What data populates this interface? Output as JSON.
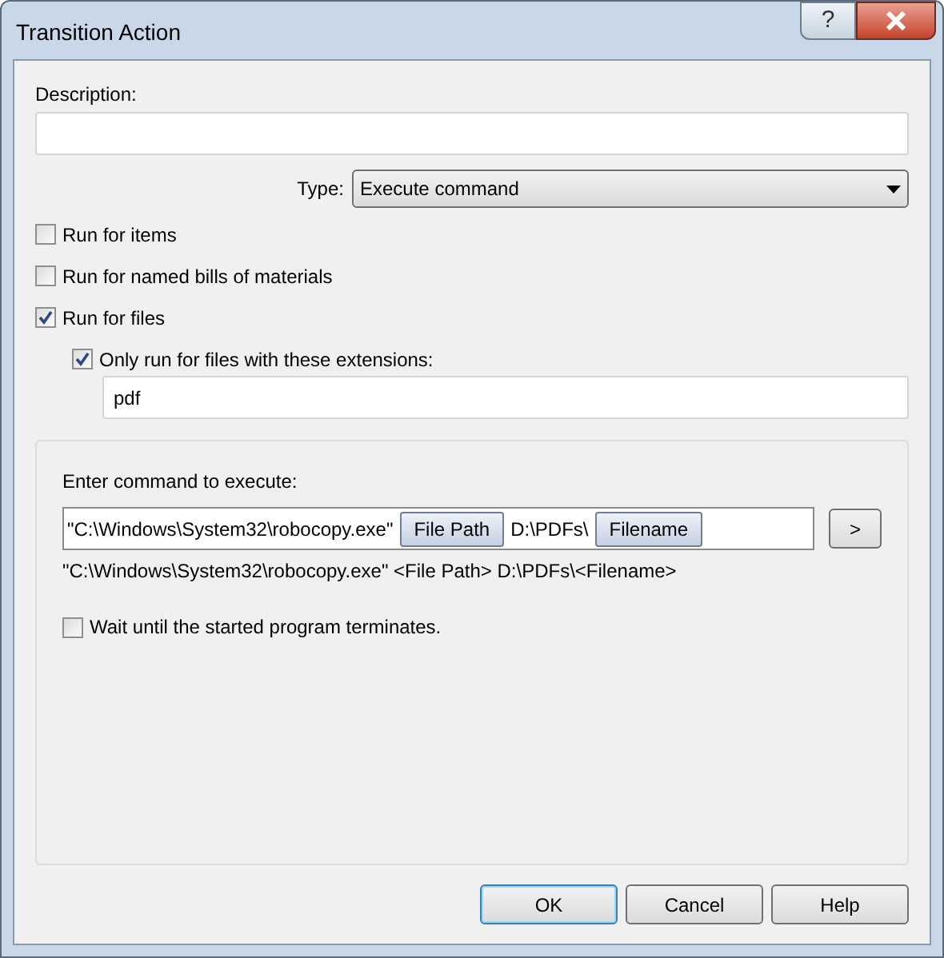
{
  "window": {
    "title": "Transition Action",
    "help_label": "?"
  },
  "description": {
    "label": "Description:"
  },
  "type": {
    "label": "Type:",
    "value": "Execute command"
  },
  "options": [
    {
      "label": "Run for items",
      "checked": false
    },
    {
      "label": "Run for named bills of materials",
      "checked": false
    },
    {
      "label": "Run for files",
      "checked": true
    }
  ],
  "extensions": {
    "label": "Only run for files with these extensions:",
    "checked": true,
    "value": "pdf"
  },
  "command": {
    "label": "Enter command to execute:",
    "segments": [
      {
        "kind": "text",
        "text": "\"C:\\Windows\\System32\\robocopy.exe\""
      },
      {
        "kind": "token",
        "text": "File Path"
      },
      {
        "kind": "text",
        "text": "D:\\PDFs\\"
      },
      {
        "kind": "token",
        "text": "Filename"
      }
    ],
    "insert_button": ">",
    "preview": "\"C:\\Windows\\System32\\robocopy.exe\" <File Path> D:\\PDFs\\<Filename>",
    "wait": {
      "label": "Wait until the started program terminates.",
      "checked": false
    }
  },
  "buttons": [
    {
      "label": "OK",
      "default": true
    },
    {
      "label": "Cancel",
      "default": false
    },
    {
      "label": "Help",
      "default": false
    }
  ]
}
